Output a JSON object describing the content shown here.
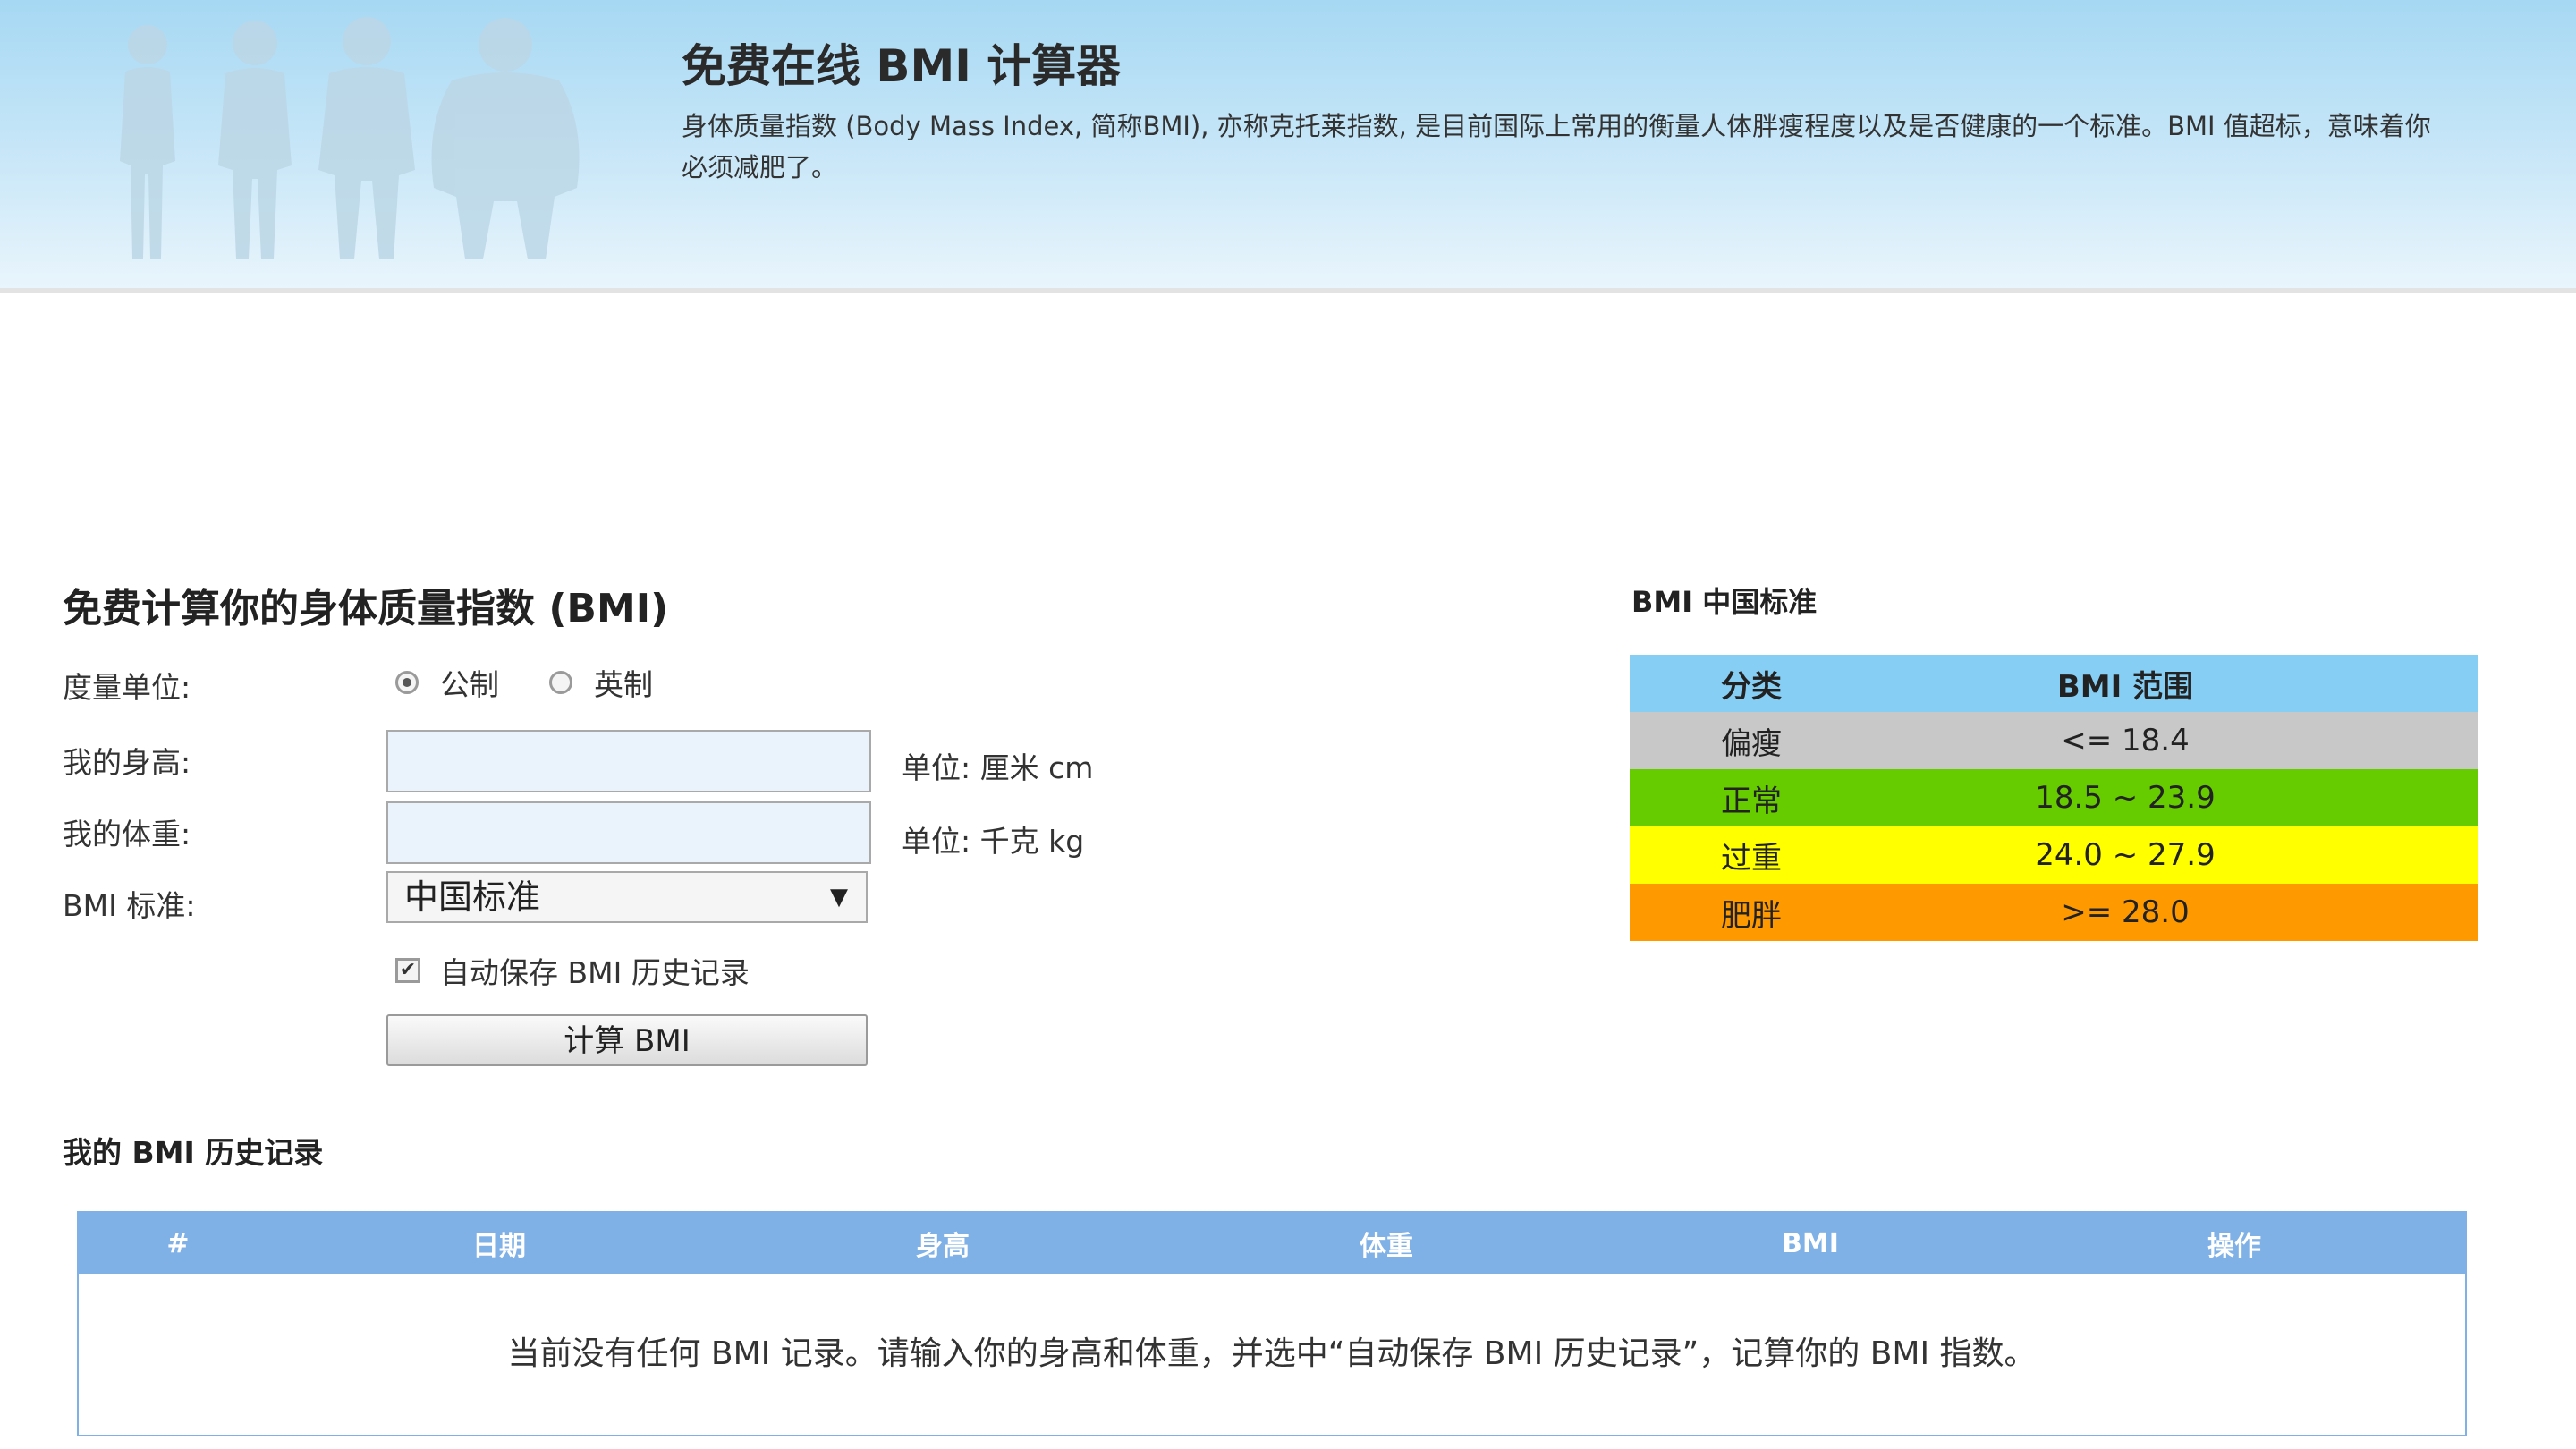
{
  "header": {
    "title": "免费在线 BMI 计算器",
    "description": "身体质量指数 (Body Mass Index, 简称BMI), 亦称克托莱指数, 是目前国际上常用的衡量人体胖瘦程度以及是否健康的一个标准。BMI 值超标，意味着你必须减肥了。"
  },
  "calculator": {
    "title": "免费计算你的身体质量指数 (BMI)",
    "unit_label": "度量单位:",
    "unit_options": [
      "公制",
      "英制"
    ],
    "unit_selected": "公制",
    "height_label": "我的身高:",
    "height_value": "",
    "height_unit": "单位: 厘米 cm",
    "weight_label": "我的体重:",
    "weight_value": "",
    "weight_unit": "单位: 千克 kg",
    "standard_label": "BMI 标准:",
    "standard_selected": "中国标准",
    "autosave_label": "自动保存 BMI 历史记录",
    "autosave_checked": true,
    "calc_button": "计算 BMI"
  },
  "standard": {
    "title": "BMI 中国标准",
    "headers": [
      "分类",
      "BMI 范围"
    ],
    "rows": [
      {
        "category": "偏瘦",
        "range": "<= 18.4",
        "color": "#c8c8c8"
      },
      {
        "category": "正常",
        "range": "18.5 ~ 23.9",
        "color": "#66cc00"
      },
      {
        "category": "过重",
        "range": "24.0 ~ 27.9",
        "color": "#ffff00"
      },
      {
        "category": "肥胖",
        "range": ">= 28.0",
        "color": "#ff9900"
      }
    ]
  },
  "history": {
    "title": "我的 BMI 历史记录",
    "headers": [
      "#",
      "日期",
      "身高",
      "体重",
      "BMI",
      "操作"
    ],
    "empty_message": "当前没有任何 BMI 记录。请输入你的身高和体重，并选中“自动保存 BMI 历史记录”，记算你的 BMI 指数。"
  },
  "colors": {
    "header_gradient_top": "#a6d8f3",
    "table_header_blue": "#87cef4",
    "history_header_blue": "#7fb1e7"
  }
}
